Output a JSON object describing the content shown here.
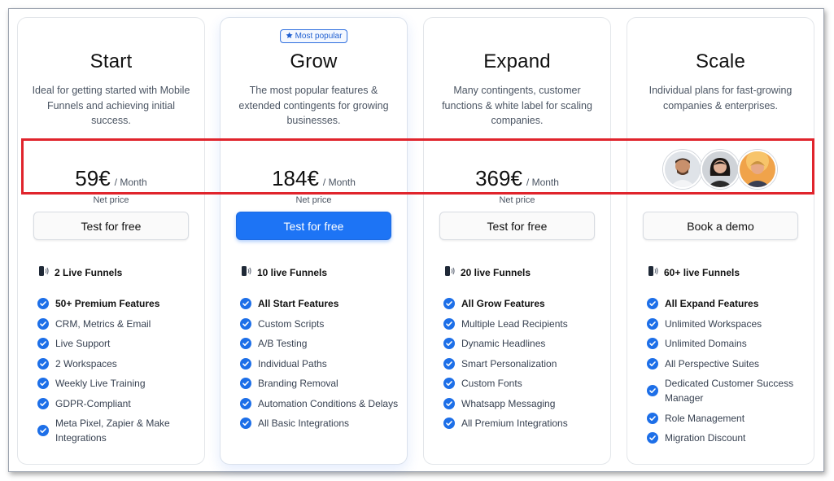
{
  "badge": {
    "label": "Most popular",
    "icon": "star-icon"
  },
  "plans": [
    {
      "title": "Start",
      "description": "Ideal for getting started with Mobile Funnels and achieving initial success.",
      "price": "59€",
      "per": "/ Month",
      "net": "Net price",
      "cta": "Test for free",
      "funnels": "2 Live Funnels",
      "features": [
        "50+ Premium Features",
        "CRM, Metrics & Email",
        "Live Support",
        "2 Workspaces",
        "Weekly Live Training",
        "GDPR-Compliant",
        "Meta Pixel, Zapier & Make Integrations"
      ]
    },
    {
      "title": "Grow",
      "description": "The most popular features & extended contingents for growing businesses.",
      "price": "184€",
      "per": "/ Month",
      "net": "Net price",
      "cta": "Test for free",
      "funnels": "10 live Funnels",
      "features": [
        "All Start Features",
        "Custom Scripts",
        "A/B Testing",
        "Individual Paths",
        "Branding Removal",
        "Automation Conditions & Delays",
        "All Basic Integrations"
      ]
    },
    {
      "title": "Expand",
      "description": "Many contingents, customer functions & white label for scaling companies.",
      "price": "369€",
      "per": "/ Month",
      "net": "Net price",
      "cta": "Test for free",
      "funnels": "20 live Funnels",
      "features": [
        "All Grow Features",
        "Multiple Lead Recipients",
        "Dynamic Headlines",
        "Smart Personalization",
        "Custom Fonts",
        "Whatsapp Messaging",
        "All Premium Integrations"
      ]
    },
    {
      "title": "Scale",
      "description": "Individual plans for fast-growing companies & enterprises.",
      "cta": "Book a demo",
      "funnels": "60+ live Funnels",
      "features": [
        "All Expand Features",
        "Unlimited Workspaces",
        "Unlimited Domains",
        "All Perspective Suites",
        "Dedicated Customer Success Manager",
        "Role Management",
        "Migration Discount"
      ]
    }
  ],
  "colors": {
    "accent": "#1d74f5",
    "highlight": "#e0242c",
    "check": "#1d6fe8"
  }
}
